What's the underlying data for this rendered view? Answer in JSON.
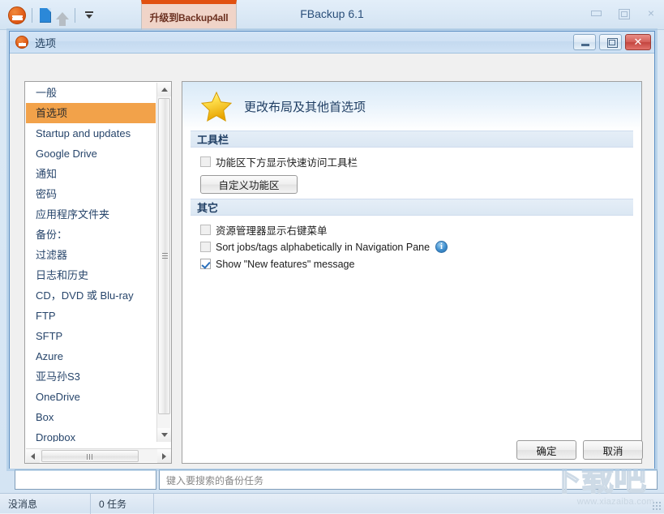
{
  "app": {
    "title": "FBackup 6.1",
    "upgrade_tab_label": "升级到Backup4all",
    "quick_access": {
      "logo_icon": "fbackup-logo-icon",
      "new_icon": "new-document-icon",
      "up_icon": "up-arrow-icon",
      "more_icon": "chevron-down-icon"
    },
    "window_controls": {
      "minimize": "minimize-icon",
      "maximize": "maximize-icon",
      "close": "×"
    },
    "search": {
      "left_value": "",
      "right_placeholder": "键入要搜索的备份任务"
    },
    "status_bar": {
      "message": "没消息",
      "tasks": "0 任务"
    },
    "watermark": {
      "logo": "下载吧",
      "url": "www.xiazaiba.com"
    }
  },
  "dialog": {
    "title": "选项",
    "icon": "fbackup-logo-icon",
    "window_controls": {
      "minimize": "minimize-icon",
      "maximize": "maximize-icon",
      "close": "✕"
    },
    "sidebar": {
      "items": [
        {
          "label": "一般",
          "selected": false
        },
        {
          "label": "首选项",
          "selected": true
        },
        {
          "label": "Startup and updates",
          "selected": false
        },
        {
          "label": "Google Drive",
          "selected": false
        },
        {
          "label": "通知",
          "selected": false
        },
        {
          "label": "密码",
          "selected": false
        },
        {
          "label": "应用程序文件夹",
          "selected": false
        },
        {
          "label": "备份：",
          "selected": false
        },
        {
          "label": "过滤器",
          "selected": false
        },
        {
          "label": "日志和历史",
          "selected": false
        },
        {
          "label": "CD，DVD 或 Blu-ray",
          "selected": false
        },
        {
          "label": "FTP",
          "selected": false
        },
        {
          "label": "SFTP",
          "selected": false
        },
        {
          "label": "Azure",
          "selected": false
        },
        {
          "label": "亚马孙S3",
          "selected": false
        },
        {
          "label": "OneDrive",
          "selected": false
        },
        {
          "label": "Box",
          "selected": false
        },
        {
          "label": "Dropbox",
          "selected": false
        }
      ],
      "scrollbar_vertical": "vertical-scrollbar",
      "scrollbar_horizontal": "horizontal-scrollbar"
    },
    "content": {
      "header_icon": "star-icon",
      "header_title": "更改布局及其他首选项",
      "groups": [
        {
          "title": "工具栏",
          "checkboxes": [
            {
              "label": "功能区下方显示快速访问工具栏",
              "checked": false,
              "info": false
            }
          ],
          "button": "自定义功能区"
        },
        {
          "title": "其它",
          "checkboxes": [
            {
              "label": "资源管理器显示右键菜单",
              "checked": false,
              "info": false
            },
            {
              "label": "Sort jobs/tags alphabetically in Navigation Pane",
              "checked": false,
              "info": true
            },
            {
              "label": "Show \"New features\" message",
              "checked": true,
              "info": false
            }
          ],
          "button": null
        }
      ]
    },
    "footer": {
      "ok_label": "确定",
      "cancel_label": "取消"
    }
  },
  "colors": {
    "accent_orange": "#f2a24a",
    "brand_orange": "#e25b18",
    "title_blue": "#1f3e63",
    "group_bar": "#e0ebf5"
  }
}
